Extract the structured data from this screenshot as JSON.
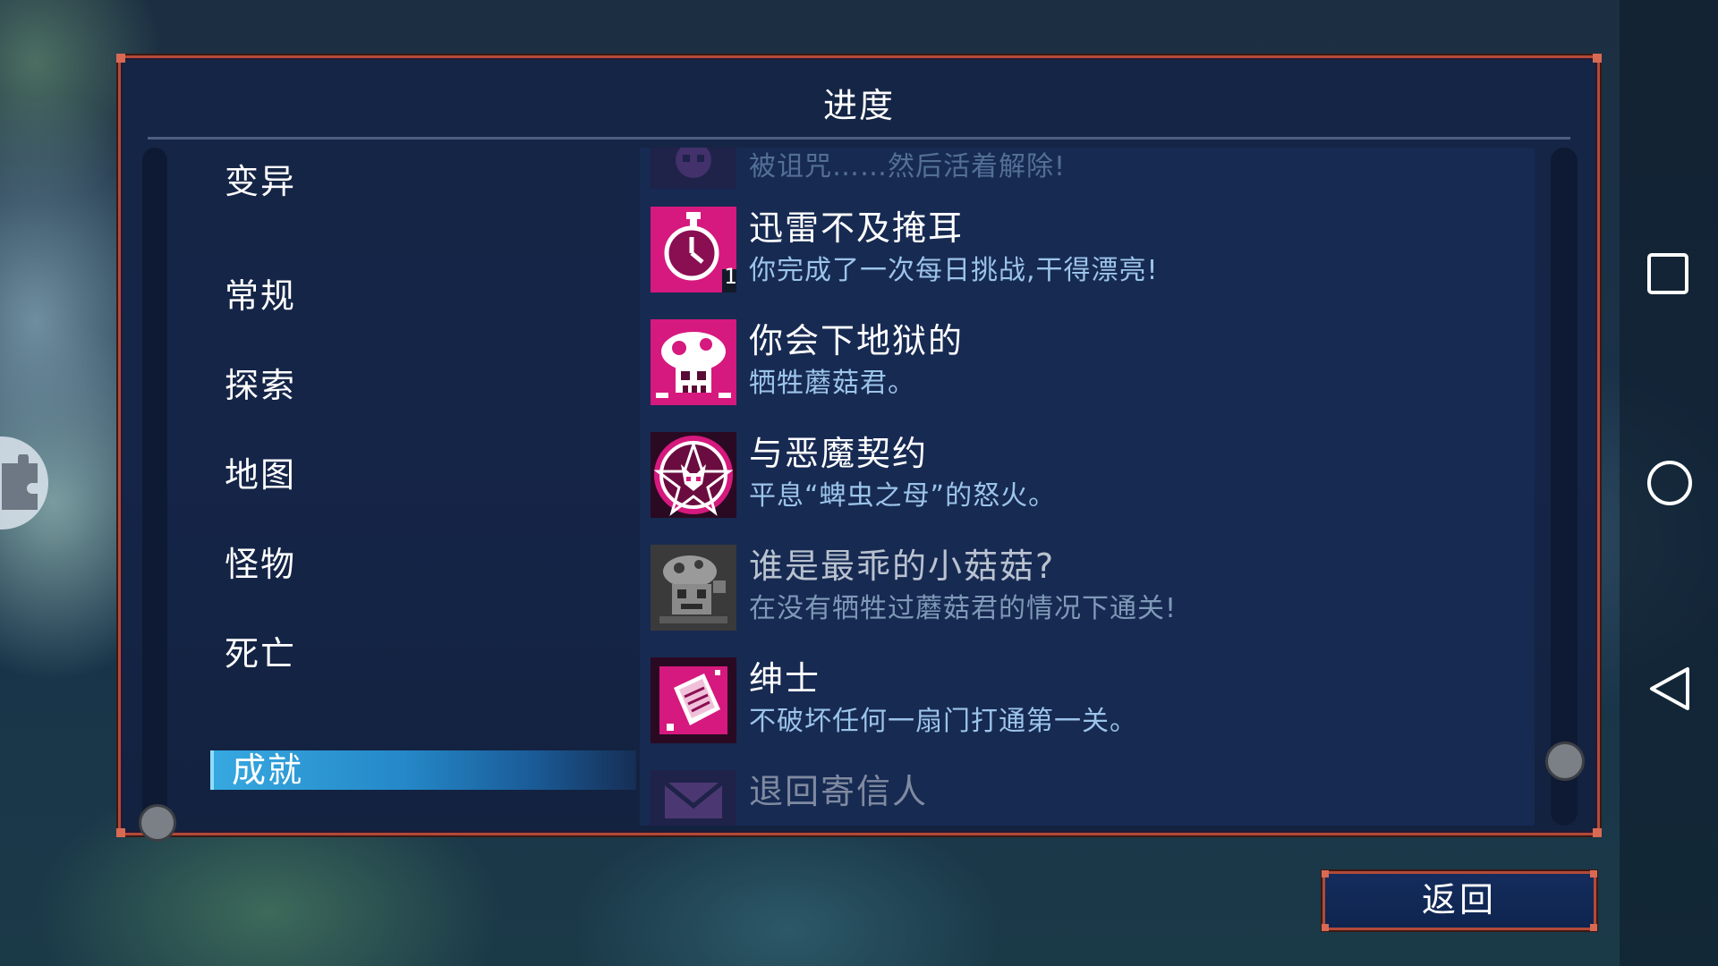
{
  "panel": {
    "title": "进度"
  },
  "categories": [
    {
      "label": "变异",
      "active": false
    },
    {
      "label": "常规",
      "active": false
    },
    {
      "label": "探索",
      "active": false
    },
    {
      "label": "地图",
      "active": false
    },
    {
      "label": "怪物",
      "active": false
    },
    {
      "label": "死亡",
      "active": false
    },
    {
      "label": "成就",
      "active": true
    }
  ],
  "achievements": [
    {
      "name": "",
      "desc": "被诅咒……然后活着解除!",
      "icon": "cursed-skull-icon",
      "state": "partial"
    },
    {
      "name": "迅雷不及掩耳",
      "desc": "你完成了一次每日挑战,干得漂亮!",
      "icon": "stopwatch-icon",
      "badge": "1",
      "state": "unlocked"
    },
    {
      "name": "你会下地狱的",
      "desc": "牺牲蘑菇君。",
      "icon": "mushroom-skull-icon",
      "state": "unlocked"
    },
    {
      "name": "与恶魔契约",
      "desc": "平息“蜱虫之母”的怒火。",
      "icon": "demon-pentagram-icon",
      "state": "unlocked"
    },
    {
      "name": "谁是最乖的小菇菇?",
      "desc": "在没有牺牲过蘑菇君的情况下通关!",
      "icon": "mushroom-pet-icon",
      "state": "locked"
    },
    {
      "name": "绅士",
      "desc": "不破坏任何一扇门打通第一关。",
      "icon": "card-book-icon",
      "state": "unlocked"
    },
    {
      "name": "退回寄信人",
      "desc": "",
      "icon": "mail-return-icon",
      "state": "partial"
    }
  ],
  "footer": {
    "back_label": "返回"
  },
  "system_nav": {
    "icons": [
      "square-icon",
      "circle-icon",
      "back-triangle-icon"
    ]
  },
  "colors": {
    "accent": "#2a9ad8",
    "frame": "#b24a3a",
    "icon_magenta": "#d6197e",
    "desc_blue": "#9cc4ea"
  }
}
